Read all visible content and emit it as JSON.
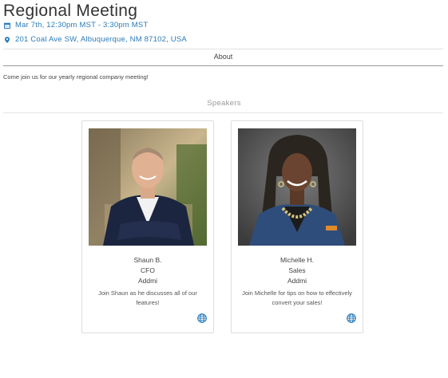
{
  "event": {
    "title": "Regional Meeting",
    "date_time": "Mar 7th, 12:30pm MST - 3:30pm MST",
    "address": "201 Coal Ave SW, Albuquerque, NM 87102, USA"
  },
  "about": {
    "tab_label": "About",
    "description": "Come join us for our yearly regional company meeting!"
  },
  "speakers": {
    "section_title": "Speakers",
    "items": [
      {
        "name": "Shaun B.",
        "role": "CFO",
        "company": "Addmi",
        "bio": "Join Shaun as he discusses all of our features!",
        "link_icon": "globe-icon"
      },
      {
        "name": "Michelle H.",
        "role": "Sales",
        "company": "Addmi",
        "bio": "Join Michelle for tips on how to effectively convert your sales!",
        "link_icon": "globe-icon"
      }
    ]
  },
  "icons": {
    "date": "calendar-icon",
    "address": "map-pin-icon"
  },
  "colors": {
    "accent": "#2b7bb9",
    "text": "#333333",
    "muted": "#999999",
    "border": "#dddddd"
  }
}
